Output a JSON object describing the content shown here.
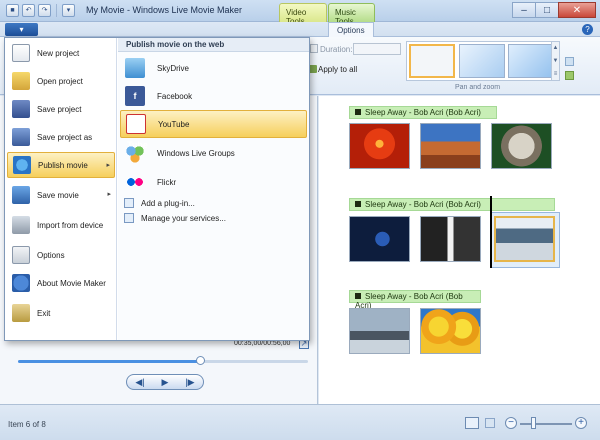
{
  "window": {
    "title": "My Movie - Windows Live Movie Maker"
  },
  "quick_access": {
    "save_icon": "save-icon",
    "undo_icon": "undo-icon",
    "redo_icon": "redo-icon"
  },
  "contextual_tabs": {
    "video_tools": "Video Tools",
    "music_tools": "Music Tools"
  },
  "ribbon": {
    "tab_options": "Options",
    "duration_label": "Duration:",
    "duration_value": "",
    "apply_to_all": "Apply to all",
    "gallery_caption": "Pan and zoom"
  },
  "app_menu": {
    "items": [
      {
        "label": "New project",
        "icon": "new-project-icon"
      },
      {
        "label": "Open project",
        "icon": "open-project-icon"
      },
      {
        "label": "Save project",
        "icon": "save-project-icon"
      },
      {
        "label": "Save project as",
        "icon": "save-project-as-icon"
      },
      {
        "label": "Publish movie",
        "icon": "publish-movie-icon",
        "submenu": true,
        "active": true
      },
      {
        "label": "Save movie",
        "icon": "save-movie-icon",
        "submenu": true
      },
      {
        "label": "Import from device",
        "icon": "import-icon"
      },
      {
        "label": "Options",
        "icon": "options-icon"
      },
      {
        "label": "About Movie Maker",
        "icon": "about-icon"
      },
      {
        "label": "Exit",
        "icon": "exit-icon"
      }
    ],
    "publish": {
      "header": "Publish movie on the web",
      "services": [
        {
          "label": "SkyDrive",
          "icon": "skydrive-icon"
        },
        {
          "label": "Facebook",
          "icon": "facebook-icon"
        },
        {
          "label": "YouTube",
          "icon": "youtube-icon",
          "active": true
        },
        {
          "label": "Windows Live Groups",
          "icon": "windows-live-groups-icon"
        },
        {
          "label": "Flickr",
          "icon": "flickr-icon"
        }
      ],
      "links": [
        {
          "label": "Add a plug-in...",
          "icon": "plugin-icon"
        },
        {
          "label": "Manage your services...",
          "icon": "manage-services-icon"
        }
      ]
    }
  },
  "preview": {
    "time": "00:35,00/00:56,00",
    "seek_progress": 0.64
  },
  "storyboard": {
    "segments": [
      {
        "label": "Sleep Away - Bob Acri (Bob Acri)"
      },
      {
        "label": "Sleep Away - Bob Acri (Bob Acri)"
      },
      {
        "label": "Sleep Away - Bob Acri (Bob Acri)"
      }
    ],
    "clips": 8
  },
  "status": {
    "text": "Item 6 of 8"
  },
  "glyphs": {
    "app_button": "▾",
    "chevron_right": "▸",
    "prev": "◀|",
    "play": "▶",
    "next": "|▶",
    "minimize": "–",
    "maximize": "□",
    "close": "✕",
    "help": "?",
    "zoom_minus": "−",
    "zoom_plus": "+",
    "expand": "↗"
  }
}
